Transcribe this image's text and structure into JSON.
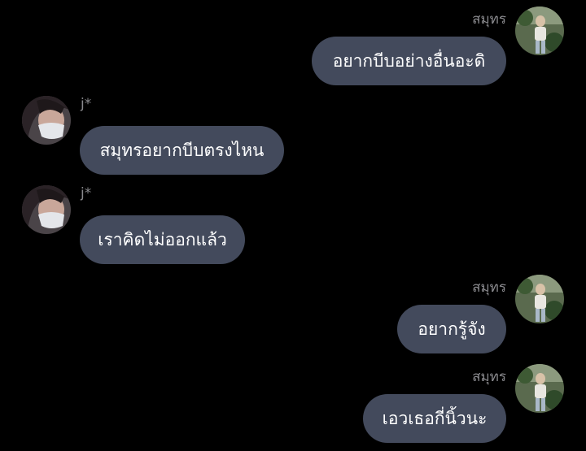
{
  "chat": {
    "messages": [
      {
        "sender": "สมุทร",
        "side": "right",
        "text": "อยากบีบอย่างอื่นอะดิ"
      },
      {
        "sender": "j*",
        "side": "left",
        "text": "สมุทรอยากบีบตรงไหน"
      },
      {
        "sender": "j*",
        "side": "left",
        "text": "เราคิดไม่ออกแล้ว"
      },
      {
        "sender": "สมุทร",
        "side": "right",
        "text": "อยากรู้จัง"
      },
      {
        "sender": "สมุทร",
        "side": "right",
        "text": "เอวเธอกี่นิ้วนะ"
      }
    ]
  },
  "theme": {
    "background": "#000000",
    "bubble": "#434a5c",
    "sender_name": "#8a8a8e"
  }
}
